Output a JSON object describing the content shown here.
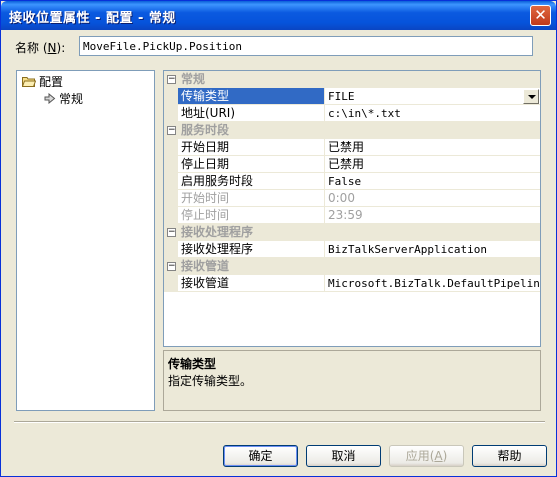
{
  "window": {
    "title": "接收位置属性 - 配置 - 常规",
    "close_glyph": "✕"
  },
  "name_field": {
    "label": "名称",
    "mnemonic_open": "(",
    "mnemonic": "N",
    "mnemonic_close": "):",
    "value": "MoveFile.PickUp.Position"
  },
  "tree": {
    "root_label": "配置",
    "child_label": "常规"
  },
  "properties": {
    "categories": {
      "general": "常规",
      "service_window": "服务时段",
      "receive_handler": "接收处理程序",
      "receive_pipeline": "接收管道"
    },
    "rows": {
      "transport_type": {
        "name": "传输类型",
        "value": "FILE"
      },
      "address": {
        "name": "地址(URI)",
        "value": "c:\\in\\*.txt"
      },
      "start_date": {
        "name": "开始日期",
        "value": "已禁用"
      },
      "stop_date": {
        "name": "停止日期",
        "value": "已禁用"
      },
      "enable_service_window": {
        "name": "启用服务时段",
        "value": "False"
      },
      "start_time": {
        "name": "开始时间",
        "value": "0:00"
      },
      "stop_time": {
        "name": "停止时间",
        "value": "23:59"
      },
      "receive_handler": {
        "name": "接收处理程序",
        "value": "BizTalkServerApplication"
      },
      "receive_pipeline": {
        "name": "接收管道",
        "value": "Microsoft.BizTalk.DefaultPipelines."
      }
    },
    "toggle_glyph": "−"
  },
  "description": {
    "title": "传输类型",
    "text": "指定传输类型。"
  },
  "buttons": {
    "ok": "确定",
    "cancel": "取消",
    "apply": "应用",
    "apply_mnemonic_open": "(",
    "apply_mnemonic": "A",
    "apply_mnemonic_close": ")",
    "help": "帮助"
  },
  "colors": {
    "titlebar": "#0653db",
    "selection": "#316ac5",
    "dialog_bg": "#ece9d8"
  }
}
